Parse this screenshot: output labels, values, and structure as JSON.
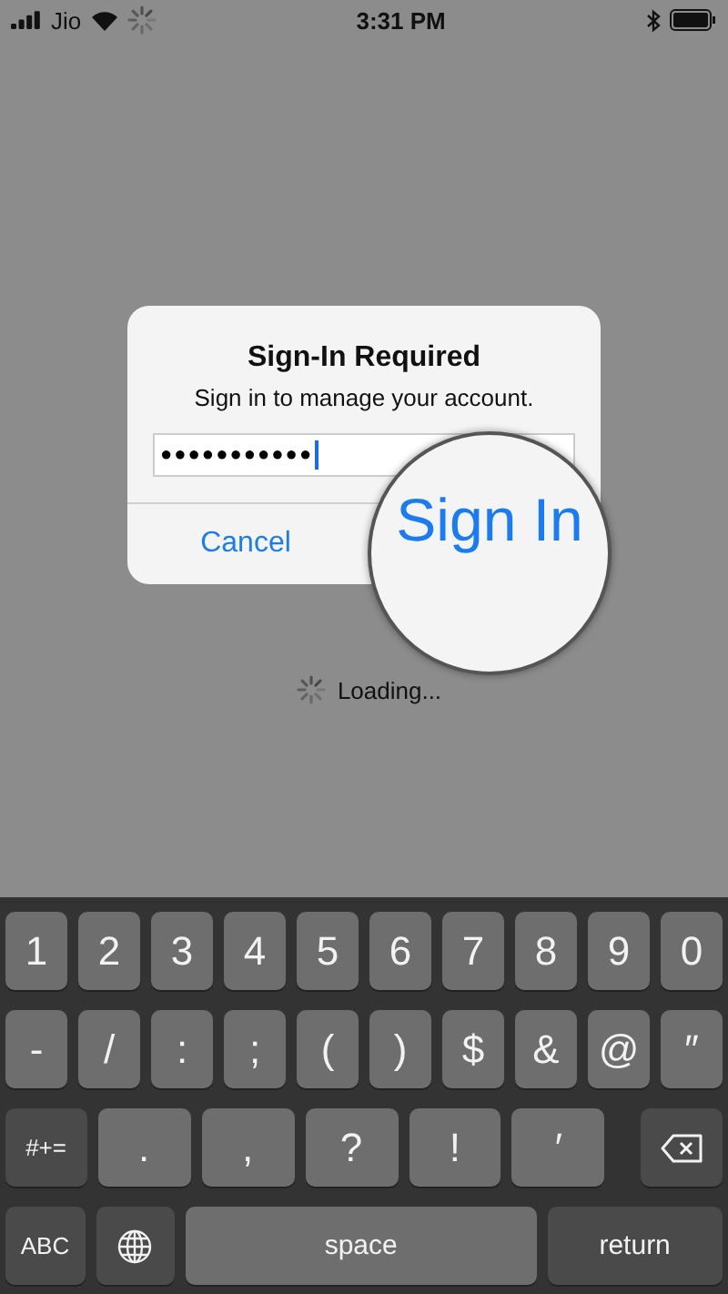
{
  "status_bar": {
    "carrier": "Jio",
    "time": "3:31 PM"
  },
  "dialog": {
    "title": "Sign-In Required",
    "message": "Sign in to manage your account.",
    "password": {
      "value": "●●●●●●●●●●●"
    },
    "cancel": "Cancel"
  },
  "magnifier": {
    "label": "Sign In"
  },
  "loading": "Loading...",
  "keyboard": [
    [
      {
        "kind": "char",
        "label": "1"
      },
      {
        "kind": "char",
        "label": "2"
      },
      {
        "kind": "char",
        "label": "3"
      },
      {
        "kind": "char",
        "label": "4"
      },
      {
        "kind": "char",
        "label": "5"
      },
      {
        "kind": "char",
        "label": "6"
      },
      {
        "kind": "char",
        "label": "7"
      },
      {
        "kind": "char",
        "label": "8"
      },
      {
        "kind": "char",
        "label": "9"
      },
      {
        "kind": "char",
        "label": "0"
      }
    ],
    [
      {
        "kind": "char",
        "label": "-"
      },
      {
        "kind": "char",
        "label": "/"
      },
      {
        "kind": "char",
        "label": ":"
      },
      {
        "kind": "char",
        "label": ";"
      },
      {
        "kind": "char",
        "label": "("
      },
      {
        "kind": "char",
        "label": ")"
      },
      {
        "kind": "char",
        "label": "$"
      },
      {
        "kind": "char",
        "label": "&"
      },
      {
        "kind": "char",
        "label": "@"
      },
      {
        "kind": "char",
        "label": "″"
      }
    ],
    [
      {
        "kind": "function",
        "label": "#+="
      },
      {
        "kind": "wide",
        "label": "."
      },
      {
        "kind": "wide",
        "label": ","
      },
      {
        "kind": "wide",
        "label": "?"
      },
      {
        "kind": "wide",
        "label": "!"
      },
      {
        "kind": "wide",
        "label": "′"
      },
      {
        "kind": "delete"
      }
    ],
    [
      {
        "kind": "function",
        "label": "ABC"
      },
      {
        "kind": "globe"
      },
      {
        "kind": "space",
        "label": "space"
      },
      {
        "kind": "return",
        "label": "return"
      }
    ]
  ]
}
